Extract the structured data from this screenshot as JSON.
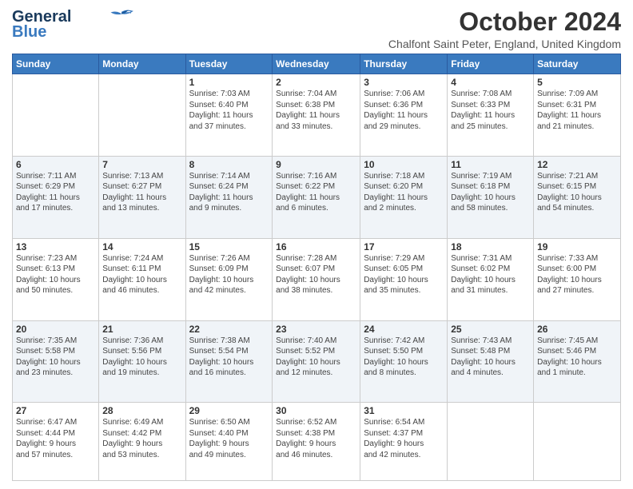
{
  "logo": {
    "line1": "General",
    "line2": "Blue"
  },
  "title": "October 2024",
  "location": "Chalfont Saint Peter, England, United Kingdom",
  "weekdays": [
    "Sunday",
    "Monday",
    "Tuesday",
    "Wednesday",
    "Thursday",
    "Friday",
    "Saturday"
  ],
  "weeks": [
    [
      {
        "day": "",
        "info": ""
      },
      {
        "day": "",
        "info": ""
      },
      {
        "day": "1",
        "info": "Sunrise: 7:03 AM\nSunset: 6:40 PM\nDaylight: 11 hours\nand 37 minutes."
      },
      {
        "day": "2",
        "info": "Sunrise: 7:04 AM\nSunset: 6:38 PM\nDaylight: 11 hours\nand 33 minutes."
      },
      {
        "day": "3",
        "info": "Sunrise: 7:06 AM\nSunset: 6:36 PM\nDaylight: 11 hours\nand 29 minutes."
      },
      {
        "day": "4",
        "info": "Sunrise: 7:08 AM\nSunset: 6:33 PM\nDaylight: 11 hours\nand 25 minutes."
      },
      {
        "day": "5",
        "info": "Sunrise: 7:09 AM\nSunset: 6:31 PM\nDaylight: 11 hours\nand 21 minutes."
      }
    ],
    [
      {
        "day": "6",
        "info": "Sunrise: 7:11 AM\nSunset: 6:29 PM\nDaylight: 11 hours\nand 17 minutes."
      },
      {
        "day": "7",
        "info": "Sunrise: 7:13 AM\nSunset: 6:27 PM\nDaylight: 11 hours\nand 13 minutes."
      },
      {
        "day": "8",
        "info": "Sunrise: 7:14 AM\nSunset: 6:24 PM\nDaylight: 11 hours\nand 9 minutes."
      },
      {
        "day": "9",
        "info": "Sunrise: 7:16 AM\nSunset: 6:22 PM\nDaylight: 11 hours\nand 6 minutes."
      },
      {
        "day": "10",
        "info": "Sunrise: 7:18 AM\nSunset: 6:20 PM\nDaylight: 11 hours\nand 2 minutes."
      },
      {
        "day": "11",
        "info": "Sunrise: 7:19 AM\nSunset: 6:18 PM\nDaylight: 10 hours\nand 58 minutes."
      },
      {
        "day": "12",
        "info": "Sunrise: 7:21 AM\nSunset: 6:15 PM\nDaylight: 10 hours\nand 54 minutes."
      }
    ],
    [
      {
        "day": "13",
        "info": "Sunrise: 7:23 AM\nSunset: 6:13 PM\nDaylight: 10 hours\nand 50 minutes."
      },
      {
        "day": "14",
        "info": "Sunrise: 7:24 AM\nSunset: 6:11 PM\nDaylight: 10 hours\nand 46 minutes."
      },
      {
        "day": "15",
        "info": "Sunrise: 7:26 AM\nSunset: 6:09 PM\nDaylight: 10 hours\nand 42 minutes."
      },
      {
        "day": "16",
        "info": "Sunrise: 7:28 AM\nSunset: 6:07 PM\nDaylight: 10 hours\nand 38 minutes."
      },
      {
        "day": "17",
        "info": "Sunrise: 7:29 AM\nSunset: 6:05 PM\nDaylight: 10 hours\nand 35 minutes."
      },
      {
        "day": "18",
        "info": "Sunrise: 7:31 AM\nSunset: 6:02 PM\nDaylight: 10 hours\nand 31 minutes."
      },
      {
        "day": "19",
        "info": "Sunrise: 7:33 AM\nSunset: 6:00 PM\nDaylight: 10 hours\nand 27 minutes."
      }
    ],
    [
      {
        "day": "20",
        "info": "Sunrise: 7:35 AM\nSunset: 5:58 PM\nDaylight: 10 hours\nand 23 minutes."
      },
      {
        "day": "21",
        "info": "Sunrise: 7:36 AM\nSunset: 5:56 PM\nDaylight: 10 hours\nand 19 minutes."
      },
      {
        "day": "22",
        "info": "Sunrise: 7:38 AM\nSunset: 5:54 PM\nDaylight: 10 hours\nand 16 minutes."
      },
      {
        "day": "23",
        "info": "Sunrise: 7:40 AM\nSunset: 5:52 PM\nDaylight: 10 hours\nand 12 minutes."
      },
      {
        "day": "24",
        "info": "Sunrise: 7:42 AM\nSunset: 5:50 PM\nDaylight: 10 hours\nand 8 minutes."
      },
      {
        "day": "25",
        "info": "Sunrise: 7:43 AM\nSunset: 5:48 PM\nDaylight: 10 hours\nand 4 minutes."
      },
      {
        "day": "26",
        "info": "Sunrise: 7:45 AM\nSunset: 5:46 PM\nDaylight: 10 hours\nand 1 minute."
      }
    ],
    [
      {
        "day": "27",
        "info": "Sunrise: 6:47 AM\nSunset: 4:44 PM\nDaylight: 9 hours\nand 57 minutes."
      },
      {
        "day": "28",
        "info": "Sunrise: 6:49 AM\nSunset: 4:42 PM\nDaylight: 9 hours\nand 53 minutes."
      },
      {
        "day": "29",
        "info": "Sunrise: 6:50 AM\nSunset: 4:40 PM\nDaylight: 9 hours\nand 49 minutes."
      },
      {
        "day": "30",
        "info": "Sunrise: 6:52 AM\nSunset: 4:38 PM\nDaylight: 9 hours\nand 46 minutes."
      },
      {
        "day": "31",
        "info": "Sunrise: 6:54 AM\nSunset: 4:37 PM\nDaylight: 9 hours\nand 42 minutes."
      },
      {
        "day": "",
        "info": ""
      },
      {
        "day": "",
        "info": ""
      }
    ]
  ]
}
